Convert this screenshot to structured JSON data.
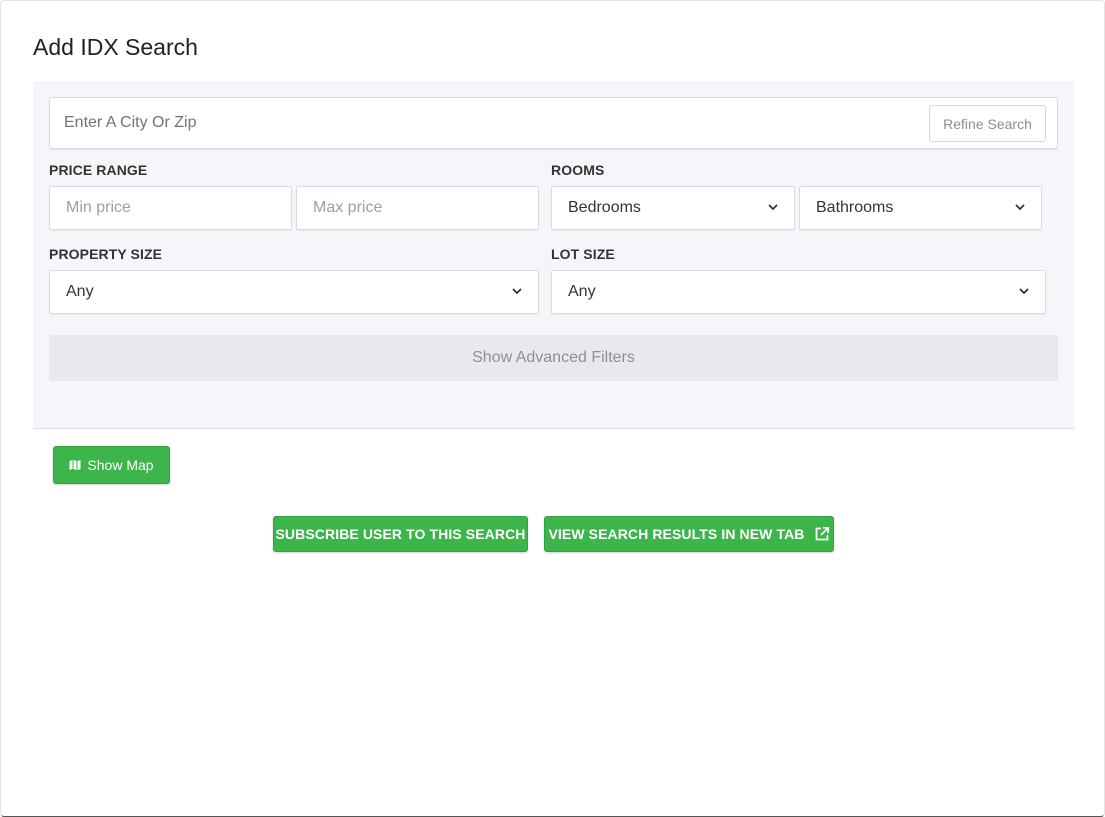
{
  "modal": {
    "title": "Add IDX Search"
  },
  "search": {
    "placeholder": "Enter A City Or Zip",
    "value": "",
    "refine_label": "Refine Search"
  },
  "price_range": {
    "label": "PRICE RANGE",
    "min_placeholder": "Min price",
    "max_placeholder": "Max price"
  },
  "rooms": {
    "label": "ROOMS",
    "bedrooms_value": "Bedrooms",
    "bathrooms_value": "Bathrooms"
  },
  "property_size": {
    "label": "PROPERTY SIZE",
    "value": "Any"
  },
  "lot_size": {
    "label": "LOT SIZE",
    "value": "Any"
  },
  "advanced": {
    "label": "Show Advanced Filters"
  },
  "map": {
    "label": "Show Map",
    "icon": "map-icon"
  },
  "actions": {
    "subscribe_label": "SUBSCRIBE USER TO THIS SEARCH",
    "view_results_label": "VIEW SEARCH RESULTS IN NEW TAB",
    "view_results_icon": "external-link-icon"
  },
  "colors": {
    "primary_green": "#3cb54a",
    "panel_bg": "#f4f6fa",
    "advanced_bg": "#e8e9ec"
  }
}
